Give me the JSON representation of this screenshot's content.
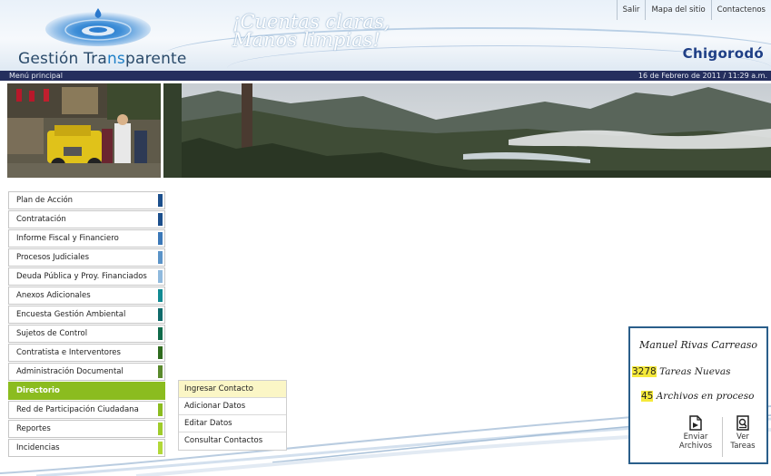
{
  "header": {
    "brand_prefix": "Gestión Tra",
    "brand_highlight": "ns",
    "brand_suffix": "parente",
    "slogan_line1": "¡Cuentas claras,",
    "slogan_line2": "Manos limpias!",
    "municipio": "Chigorodó",
    "top_links": [
      "Salir",
      "Mapa del sitio",
      "Contactenos"
    ]
  },
  "menubar": {
    "label": "Menú principal",
    "datetime": "16 de Febrero de 2011 / 11:29 a.m."
  },
  "menu": {
    "items": [
      {
        "label": "Plan de Acción",
        "color": "#1c4f8c"
      },
      {
        "label": "Contratación",
        "color": "#1c4f8c"
      },
      {
        "label": "Informe Fiscal y Financiero",
        "color": "#3b78b8"
      },
      {
        "label": "Procesos Judiciales",
        "color": "#5a93c8"
      },
      {
        "label": "Deuda Pública y Proy. Financiados",
        "color": "#8fb9dd"
      },
      {
        "label": "Anexos Adicionales",
        "color": "#118a92"
      },
      {
        "label": "Encuesta Gestión Ambiental",
        "color": "#0f6a6a"
      },
      {
        "label": "Sujetos de Control",
        "color": "#0f6a4a"
      },
      {
        "label": "Contratista e Interventores",
        "color": "#2f6b1e"
      },
      {
        "label": "Administración Documental",
        "color": "#5a8a2c"
      },
      {
        "label": "Directorio",
        "color": "#8bbc1f",
        "active": true
      },
      {
        "label": "Red de Participación Ciudadana",
        "color": "#8bbc1f"
      },
      {
        "label": "Reportes",
        "color": "#9fcc2a"
      },
      {
        "label": "Incidencias",
        "color": "#b2d838"
      }
    ]
  },
  "submenu": {
    "items": [
      "Ingresar Contacto",
      "Adicionar Datos",
      "Editar Datos",
      "Consultar Contactos"
    ]
  },
  "user_panel": {
    "name": "Manuel Rivas Carreaso",
    "tasks_count": "3278",
    "tasks_label": " Tareas Nuevas",
    "files_count": "45",
    "files_label": " Archivos en proceso",
    "send_line1": "Enviar",
    "send_line2": "Archivos",
    "view_line1": "Ver",
    "view_line2": "Tareas"
  }
}
